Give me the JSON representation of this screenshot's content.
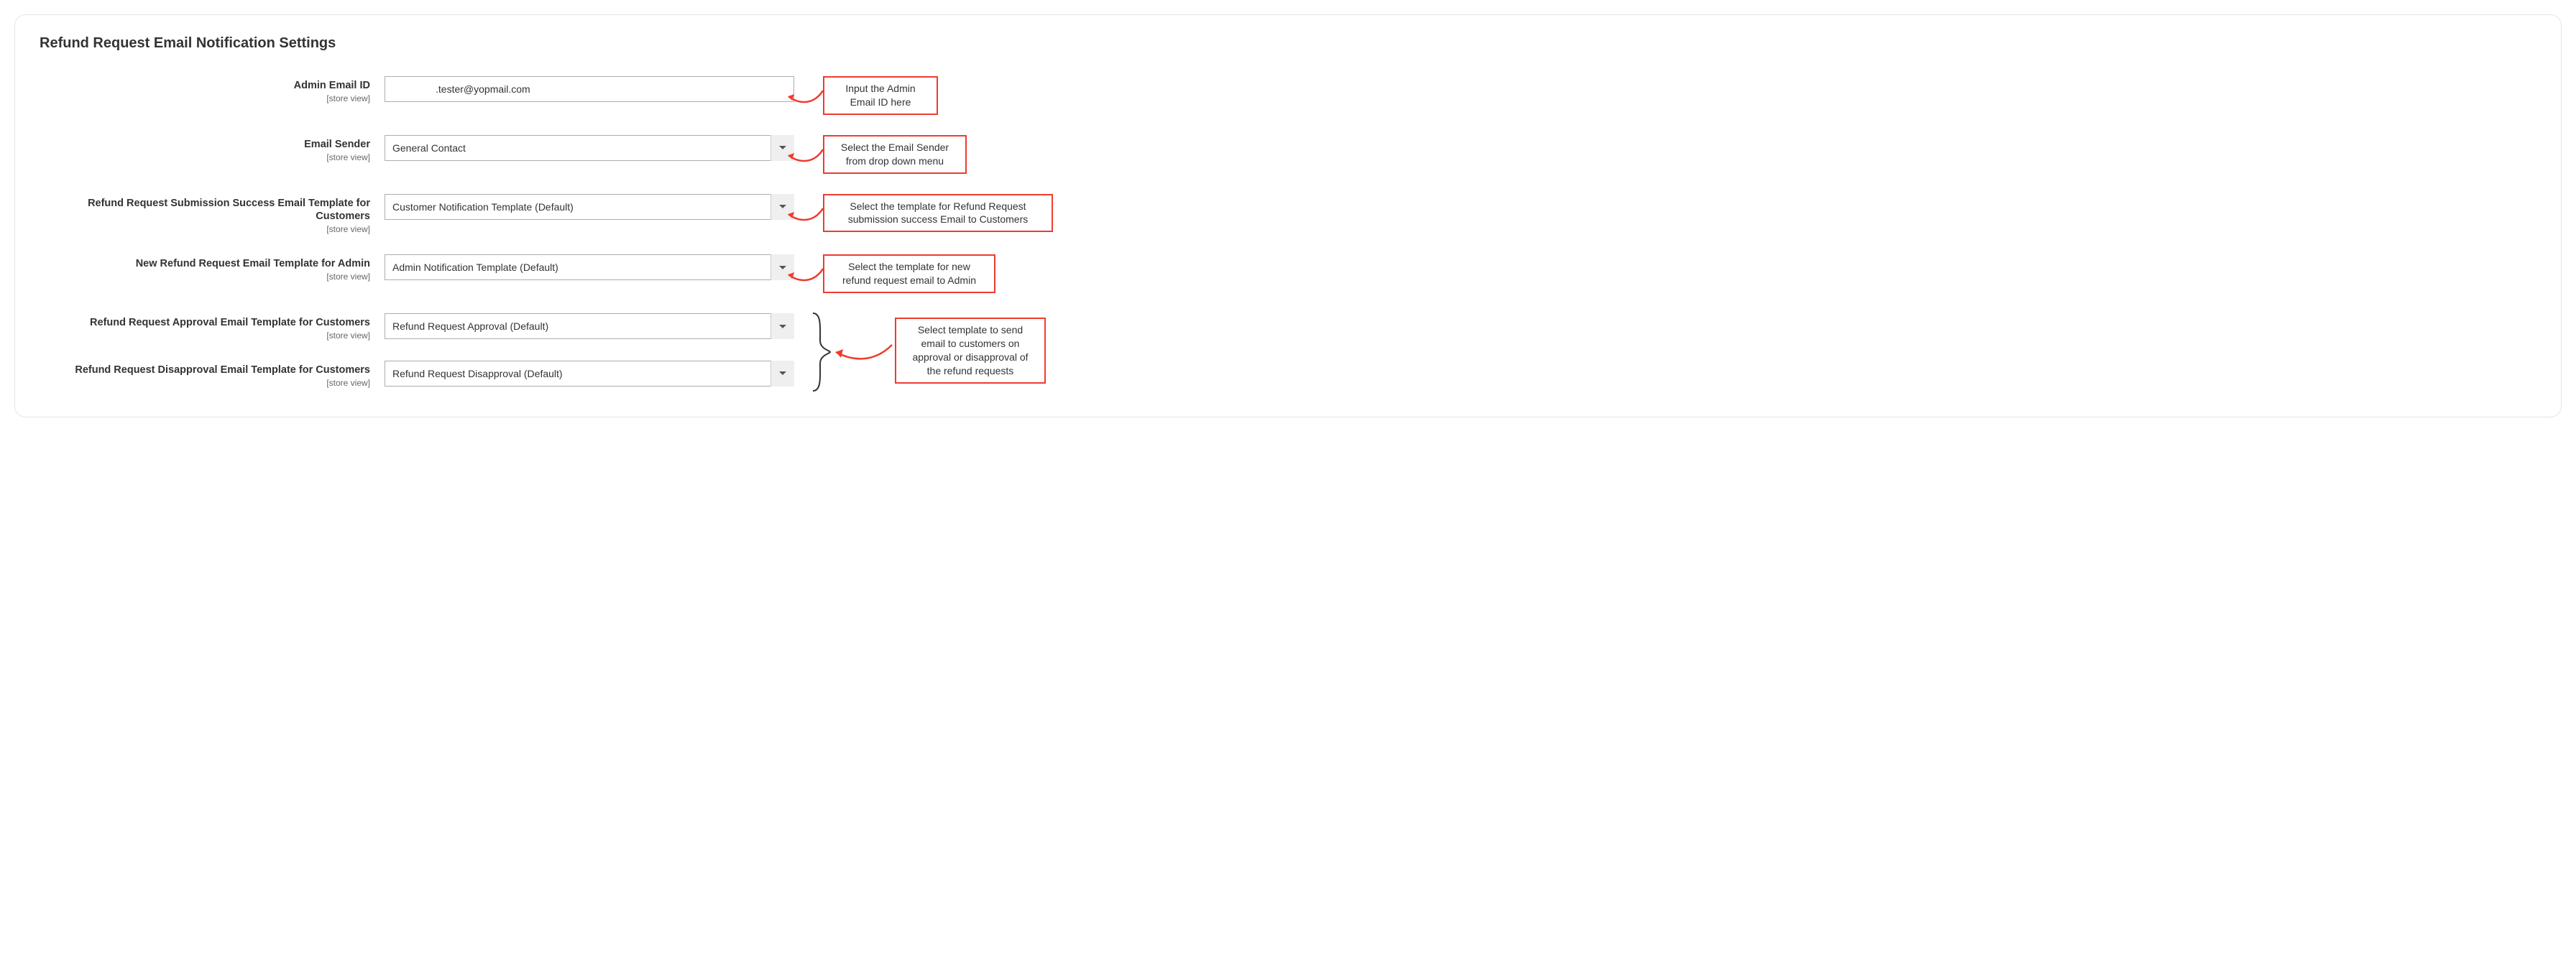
{
  "section": {
    "title": "Refund Request Email Notification Settings"
  },
  "scope_label": "[store view]",
  "fields": {
    "admin_email": {
      "label": "Admin Email ID",
      "value": ".tester@yopmail.com"
    },
    "email_sender": {
      "label": "Email Sender",
      "value": "General Contact"
    },
    "submission_success_tpl": {
      "label": "Refund Request Submission Success Email Template for Customers",
      "value": "Customer Notification Template (Default)"
    },
    "new_request_admin_tpl": {
      "label": "New Refund Request Email Template for Admin",
      "value": "Admin Notification Template (Default)"
    },
    "approval_tpl": {
      "label": "Refund Request Approval Email Template for Customers",
      "value": "Refund Request Approval (Default)"
    },
    "disapproval_tpl": {
      "label": "Refund Request Disapproval Email Template for Customers",
      "value": "Refund Request Disapproval (Default)"
    }
  },
  "annotations": {
    "admin_email": "Input the Admin Email ID here",
    "email_sender": "Select the Email Sender from drop down menu",
    "submission_success_tpl": "Select the template for Refund Request submission success Email to Customers",
    "new_request_admin_tpl": "Select the template for new refund request email to Admin",
    "approval_disapproval_group": "Select template to send email to customers on approval or disapproval of the refund requests"
  }
}
